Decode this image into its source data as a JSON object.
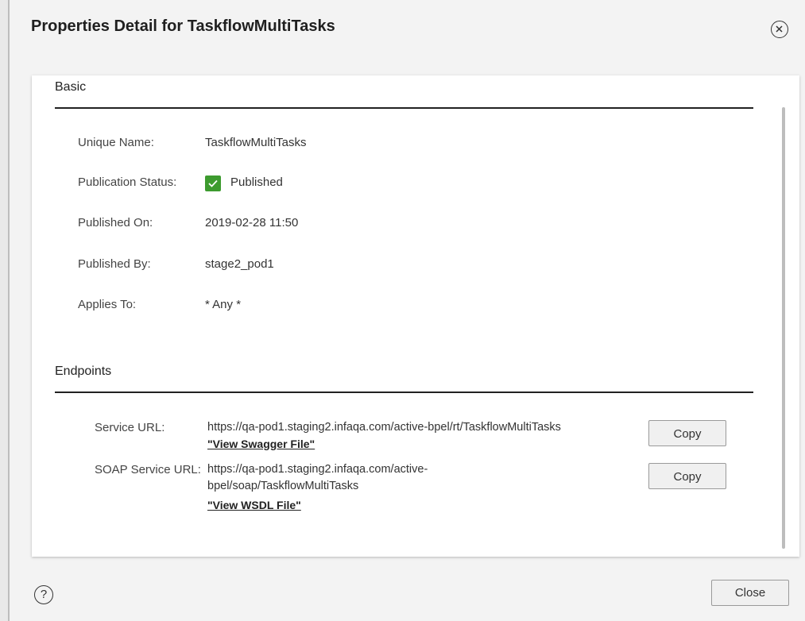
{
  "dialog": {
    "title": "Properties Detail for TaskflowMultiTasks",
    "close_icon": "close-circle-icon",
    "help_icon": "question-circle-icon",
    "help_glyph": "?",
    "close_button_label": "Close"
  },
  "basic": {
    "title": "Basic",
    "unique_name_label": "Unique Name:",
    "unique_name_value": "TaskflowMultiTasks",
    "publication_status_label": "Publication Status:",
    "publication_status_value": "Published",
    "status_color": "#3d9b2f",
    "published_on_label": "Published On:",
    "published_on_value": "2019-02-28 11:50",
    "published_by_label": "Published By:",
    "published_by_value": "stage2_pod1",
    "applies_to_label": "Applies To:",
    "applies_to_value": "* Any *"
  },
  "endpoints": {
    "title": "Endpoints",
    "service_url_label": "Service URL:",
    "service_url_value": "https://qa-pod1.staging2.infaqa.com/active-bpel/rt/TaskflowMultiTasks",
    "swagger_link": "\"View Swagger File\"",
    "soap_service_url_label": "SOAP Service URL:",
    "soap_service_url_line1": "https://qa-pod1.staging2.infaqa.com/active-",
    "soap_service_url_line2": "bpel/soap/TaskflowMultiTasks",
    "wsdl_link": "\"View WSDL File\"",
    "copy_label": "Copy"
  }
}
